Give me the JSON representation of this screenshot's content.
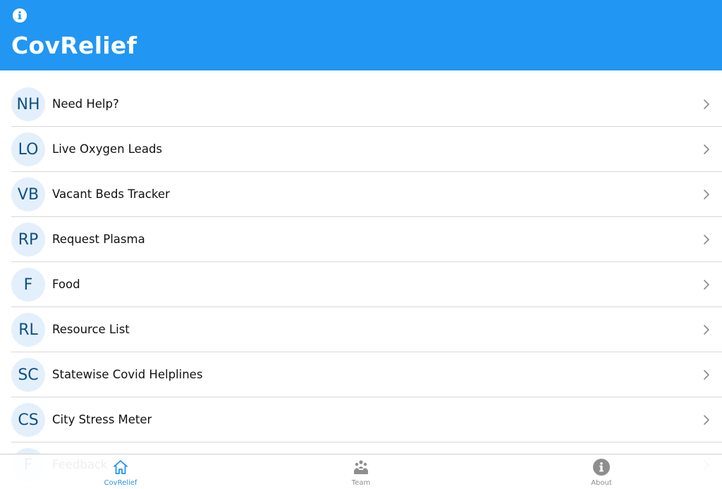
{
  "app": {
    "title": "CovRelief"
  },
  "colors": {
    "header": "#2196F3",
    "avatar_bg": "#e3f0fb",
    "avatar_text": "#0f4f86",
    "tab_active": "#2196F3",
    "tab_inactive": "#8e8e8e"
  },
  "menu": {
    "items": [
      {
        "initials": "NH",
        "label": "Need Help?"
      },
      {
        "initials": "LO",
        "label": "Live Oxygen Leads"
      },
      {
        "initials": "VB",
        "label": "Vacant Beds Tracker"
      },
      {
        "initials": "RP",
        "label": "Request Plasma"
      },
      {
        "initials": "F",
        "label": "Food"
      },
      {
        "initials": "RL",
        "label": "Resource List"
      },
      {
        "initials": "SC",
        "label": "Statewise Covid Helplines"
      },
      {
        "initials": "CS",
        "label": "City Stress Meter"
      },
      {
        "initials": "F",
        "label": "Feedback"
      }
    ]
  },
  "tabs": [
    {
      "label": "CovRelief",
      "icon": "home-icon",
      "active": true
    },
    {
      "label": "Team",
      "icon": "team-icon",
      "active": false
    },
    {
      "label": "About",
      "icon": "info-icon",
      "active": false
    }
  ]
}
